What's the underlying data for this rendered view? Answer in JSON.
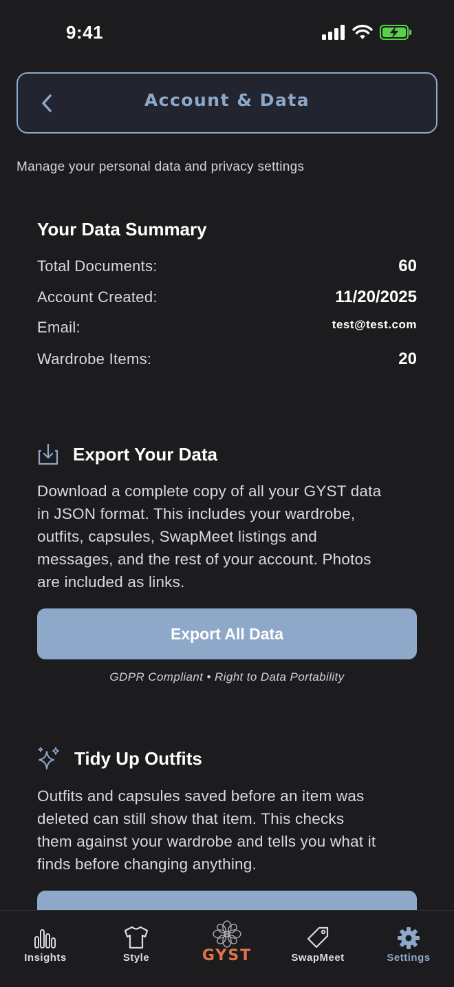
{
  "status_bar": {
    "time": "9:41"
  },
  "header": {
    "title": "Account & Data"
  },
  "subtitle": "Manage your personal data and privacy settings",
  "summary": {
    "title": "Your Data Summary",
    "rows": [
      {
        "label": "Total Documents:",
        "value": "60"
      },
      {
        "label": "Account Created:",
        "value": "11/20/2025"
      },
      {
        "label": "Email:",
        "value": "test@test.com"
      },
      {
        "label": "Wardrobe Items:",
        "value": "20"
      }
    ]
  },
  "export": {
    "title": "Export Your Data",
    "lines": [
      "Download a complete copy of all your GYST data",
      "in JSON format. This includes your wardrobe,",
      "outfits, capsules, SwapMeet listings and",
      "messages, and the rest of your account. Photos",
      "are included as links."
    ],
    "button_label": "Export All Data",
    "note": "GDPR Compliant • Right to Data Portability"
  },
  "tidy": {
    "title": "Tidy Up Outfits",
    "lines": [
      "Outfits and capsules saved before an item was",
      "deleted can still show that item. This checks",
      "them against your wardrobe and tells you what it",
      "finds before changing anything."
    ]
  },
  "tab_bar": {
    "tabs": [
      {
        "label": "Insights",
        "icon": "bar-chart-icon"
      },
      {
        "label": "Style",
        "icon": "tshirt-icon"
      },
      {
        "label": "GYST",
        "icon": "flower-logo-icon"
      },
      {
        "label": "SwapMeet",
        "icon": "tag-icon"
      },
      {
        "label": "Settings",
        "icon": "gear-icon"
      }
    ],
    "active": "Settings"
  },
  "colors": {
    "accent": "#8ea8c9",
    "background": "#1c1c1f",
    "brand": "#e2744a",
    "battery": "#5ad14a"
  }
}
